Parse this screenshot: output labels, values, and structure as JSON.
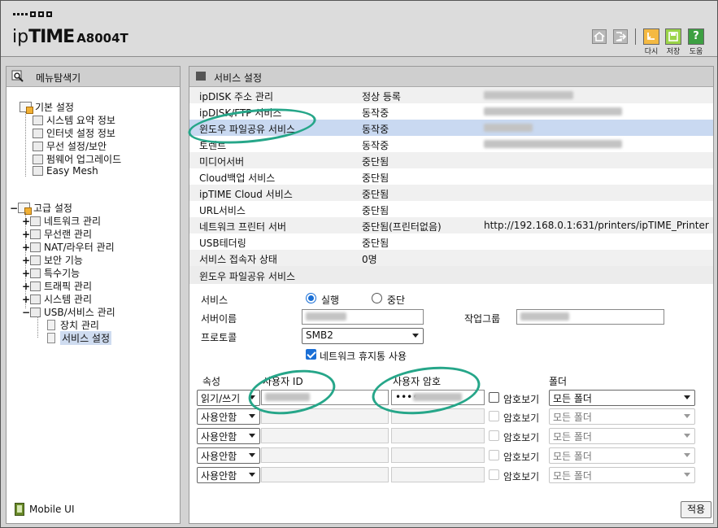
{
  "header": {
    "brand_ip": "ip",
    "brand_time": "TIME",
    "model": "A8004T",
    "buttons": {
      "undo": "다시",
      "save": "저장",
      "help": "도움",
      "help_glyph": "?"
    }
  },
  "sidebar": {
    "title": "메뉴탐색기",
    "basic": {
      "label": "기본 설정",
      "items": [
        "시스템 요약 정보",
        "인터넷 설정 정보",
        "무선 설정/보안",
        "펌웨어 업그레이드",
        "Easy Mesh"
      ]
    },
    "advanced": {
      "label": "고급 설정",
      "items": [
        "네트워크 관리",
        "무선랜 관리",
        "NAT/라우터 관리",
        "보안 기능",
        "특수기능",
        "트래픽 관리",
        "시스템 관리",
        "USB/서비스 관리"
      ],
      "usb_children": [
        "장치 관리",
        "서비스 설정"
      ]
    },
    "mobile": "Mobile UI"
  },
  "main": {
    "title": "서비스 설정",
    "services": [
      {
        "name": "ipDISK 주소 관리",
        "status": "정상 등록",
        "info": ""
      },
      {
        "name": "ipDISK/FTP 서비스",
        "status": "동작중",
        "info": ""
      },
      {
        "name": "윈도우 파일공유 서비스",
        "status": "동작중",
        "info": ""
      },
      {
        "name": "토렌트",
        "status": "동작중",
        "info": ""
      },
      {
        "name": "미디어서버",
        "status": "중단됨",
        "info": ""
      },
      {
        "name": "Cloud백업 서비스",
        "status": "중단됨",
        "info": ""
      },
      {
        "name": "ipTIME Cloud 서비스",
        "status": "중단됨",
        "info": ""
      },
      {
        "name": "URL서비스",
        "status": "중단됨",
        "info": ""
      },
      {
        "name": "네트워크 프린터 서버",
        "status": "중단됨(프린터없음)",
        "info": "http://192.168.0.1:631/printers/ipTIME_Printer"
      },
      {
        "name": "USB테더링",
        "status": "중단됨",
        "info": ""
      },
      {
        "name": "서비스 접속자 상태",
        "status": "0명",
        "info": ""
      }
    ],
    "section2": {
      "title": "윈도우 파일공유 서비스",
      "service_label": "서비스",
      "run_label": "실행",
      "stop_label": "중단",
      "servername_label": "서버이름",
      "workgroup_label": "작업그룹",
      "protocol_label": "프로토콜",
      "protocol_value": "SMB2",
      "netbios_label": "네트워크 휴지통 사용",
      "col_attr": "속성",
      "col_userid": "사용자 ID",
      "col_password": "사용자 암호",
      "col_folder": "폴더",
      "show_password": "암호보기",
      "users": [
        {
          "attr": "읽기/쓰기",
          "password": "••••",
          "folder": "모든 폴더",
          "enabled": true
        },
        {
          "attr": "사용안함",
          "password": "",
          "folder": "모든 폴더",
          "enabled": false
        },
        {
          "attr": "사용안함",
          "password": "",
          "folder": "모든 폴더",
          "enabled": false
        },
        {
          "attr": "사용안함",
          "password": "",
          "folder": "모든 폴더",
          "enabled": false
        },
        {
          "attr": "사용안함",
          "password": "",
          "folder": "모든 폴더",
          "enabled": false
        }
      ],
      "apply": "적용"
    }
  }
}
